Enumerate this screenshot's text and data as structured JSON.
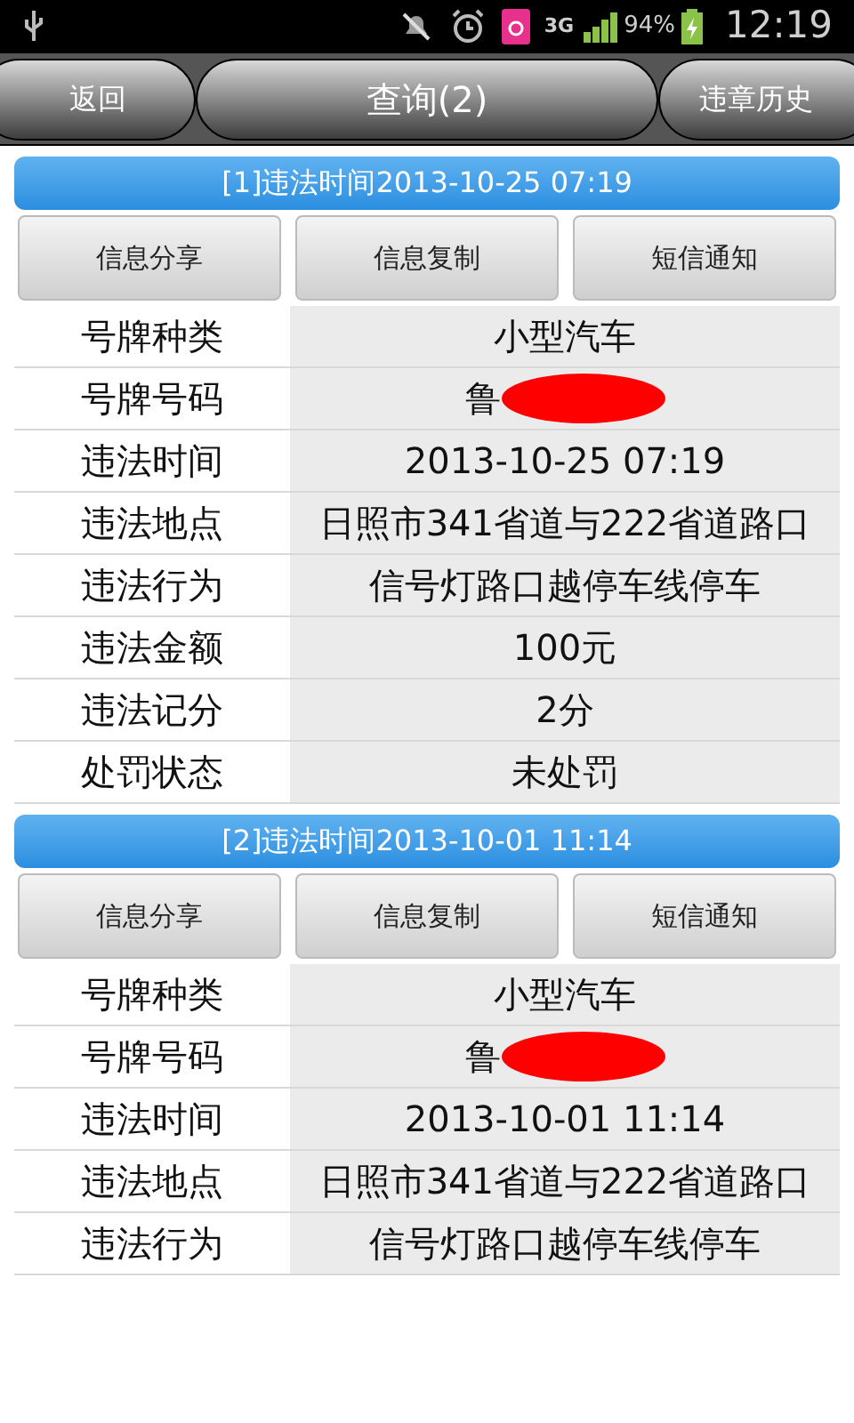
{
  "status_bar": {
    "network": "3G",
    "battery": "94%",
    "time": "12:19"
  },
  "nav": {
    "back": "返回",
    "title": "查询(2)",
    "history": "违章历史"
  },
  "records": [
    {
      "title": "[1]违法时间2013-10-25 07:19",
      "actions": [
        "信息分享",
        "信息复制",
        "短信通知"
      ],
      "fields": [
        {
          "label": "号牌种类",
          "value": "小型汽车",
          "redacted": false
        },
        {
          "label": "号牌号码",
          "value": "鲁",
          "redacted": true
        },
        {
          "label": "违法时间",
          "value": "2013-10-25 07:19",
          "redacted": false
        },
        {
          "label": "违法地点",
          "value": "日照市341省道与222省道路口",
          "redacted": false
        },
        {
          "label": "违法行为",
          "value": "信号灯路口越停车线停车",
          "redacted": false
        },
        {
          "label": "违法金额",
          "value": "100元",
          "redacted": false
        },
        {
          "label": "违法记分",
          "value": "2分",
          "redacted": false
        },
        {
          "label": "处罚状态",
          "value": "未处罚",
          "redacted": false
        }
      ]
    },
    {
      "title": "[2]违法时间2013-10-01 11:14",
      "actions": [
        "信息分享",
        "信息复制",
        "短信通知"
      ],
      "fields": [
        {
          "label": "号牌种类",
          "value": "小型汽车",
          "redacted": false
        },
        {
          "label": "号牌号码",
          "value": "鲁",
          "redacted": true
        },
        {
          "label": "违法时间",
          "value": "2013-10-01 11:14",
          "redacted": false
        },
        {
          "label": "违法地点",
          "value": "日照市341省道与222省道路口",
          "redacted": false
        },
        {
          "label": "违法行为",
          "value": "信号灯路口越停车线停车",
          "redacted": false
        }
      ]
    }
  ]
}
